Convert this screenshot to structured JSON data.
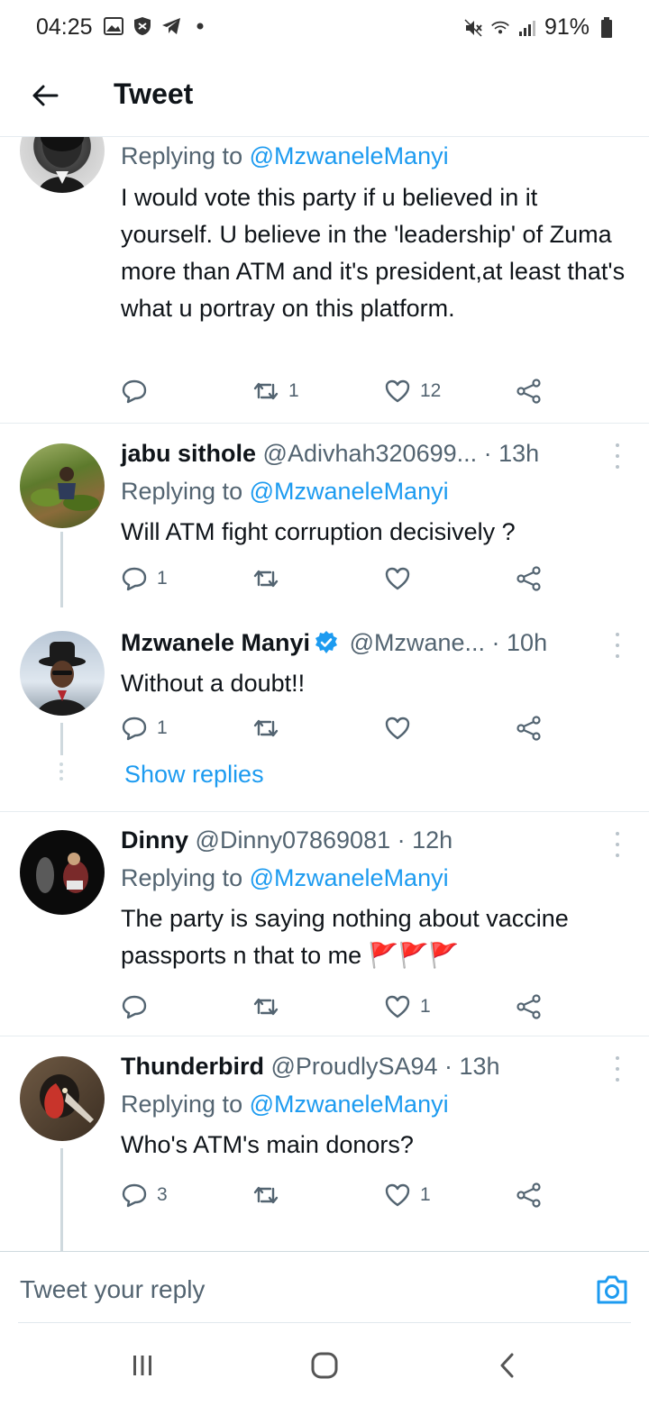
{
  "status_bar": {
    "time": "04:25",
    "battery": "91%",
    "icons_left": [
      "gallery-icon",
      "shield-icon",
      "telegram-icon",
      "dot-icon"
    ],
    "icons_right": [
      "mute-icon",
      "wifi-icon",
      "signal-icon",
      "battery-icon"
    ]
  },
  "header": {
    "title": "Tweet",
    "back_icon": "arrow-left-icon"
  },
  "tweets": [
    {
      "replying_label": "Replying to",
      "replying_handle": "@MzwaneleManyi",
      "text": "I would vote this party if u believed in it yourself. U believe in the 'leadership' of Zuma more than ATM and it's president,at least that's what u portray on this platform.",
      "replies": "",
      "retweets": "1",
      "likes": "12"
    },
    {
      "name": "jabu sithole",
      "handle": "@Adivhah320699...",
      "time": "· 13h",
      "replying_label": "Replying to",
      "replying_handle": "@MzwaneleManyi",
      "text": "Will ATM fight corruption decisively ?",
      "replies": "1",
      "retweets": "",
      "likes": ""
    },
    {
      "name": "Mzwanele Manyi",
      "verified": true,
      "handle": "@Mzwane...",
      "time": "· 10h",
      "text": "Without a doubt!!",
      "replies": "1",
      "retweets": "",
      "likes": "",
      "show_replies": "Show replies"
    },
    {
      "name": "Dinny",
      "handle": "@Dinny07869081",
      "time": "· 12h",
      "replying_label": "Replying to",
      "replying_handle": "@MzwaneleManyi",
      "text": "The party is saying nothing about vaccine passports n that to me",
      "emoji": "🚩🚩🚩",
      "replies": "",
      "retweets": "",
      "likes": "1"
    },
    {
      "name": "Thunderbird",
      "handle": "@ProudlySA94",
      "time": "· 13h",
      "replying_label": "Replying to",
      "replying_handle": "@MzwaneleManyi",
      "text": "Who's ATM's main donors?",
      "replies": "3",
      "retweets": "",
      "likes": "1"
    }
  ],
  "composer": {
    "placeholder": "Tweet your reply",
    "camera_icon": "camera-icon"
  },
  "nav": {
    "recents_icon": "recents-icon",
    "home_icon": "home-icon",
    "back_icon": "nav-back-icon"
  },
  "colors": {
    "accent": "#1d9bf0",
    "text": "#0f1419",
    "secondary": "#536471",
    "divider": "#e6ecf0",
    "flag": "#e0245e"
  }
}
